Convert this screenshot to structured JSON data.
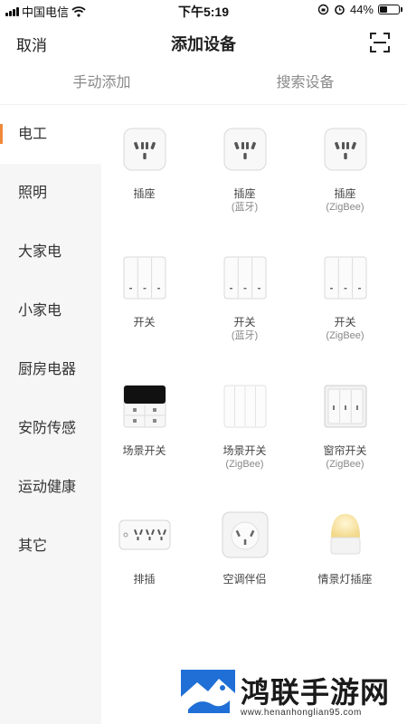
{
  "status_bar": {
    "carrier": "中国电信",
    "time": "下午5:19",
    "battery_text": "44%",
    "battery_level": 0.44
  },
  "nav": {
    "cancel_label": "取消",
    "title": "添加设备",
    "scan_icon": "scan-icon"
  },
  "tabs": [
    {
      "label": "手动添加"
    },
    {
      "label": "搜索设备"
    }
  ],
  "categories": [
    {
      "label": "电工",
      "active": true
    },
    {
      "label": "照明",
      "active": false
    },
    {
      "label": "大家电",
      "active": false
    },
    {
      "label": "小家电",
      "active": false
    },
    {
      "label": "厨房电器",
      "active": false
    },
    {
      "label": "安防传感",
      "active": false
    },
    {
      "label": "运动健康",
      "active": false
    },
    {
      "label": "其它",
      "active": false
    }
  ],
  "devices": [
    {
      "name": "插座",
      "sub": "",
      "icon": "socket-icon"
    },
    {
      "name": "插座",
      "sub": "(蓝牙)",
      "icon": "socket-icon"
    },
    {
      "name": "插座",
      "sub": "(ZigBee)",
      "icon": "socket-icon"
    },
    {
      "name": "开关",
      "sub": "",
      "icon": "wall-switch-icon"
    },
    {
      "name": "开关",
      "sub": "(蓝牙)",
      "icon": "wall-switch-icon"
    },
    {
      "name": "开关",
      "sub": "(ZigBee)",
      "icon": "wall-switch-icon"
    },
    {
      "name": "场景开关",
      "sub": "",
      "icon": "scene-panel-icon"
    },
    {
      "name": "场景开关",
      "sub": "(ZigBee)",
      "icon": "scene-switch-icon"
    },
    {
      "name": "窗帘开关",
      "sub": "(ZigBee)",
      "icon": "curtain-switch-icon"
    },
    {
      "name": "排插",
      "sub": "",
      "icon": "power-strip-icon"
    },
    {
      "name": "空调伴侣",
      "sub": "",
      "icon": "ac-companion-icon"
    },
    {
      "name": "情景灯插座",
      "sub": "",
      "icon": "night-lamp-icon"
    }
  ],
  "watermark": {
    "text": "鸿联手游网",
    "url": "www.henanhonglian95.com"
  },
  "colors": {
    "accent": "#f0883a",
    "sidebar_bg": "#f6f6f6",
    "tab_text": "#8a8a8a"
  }
}
